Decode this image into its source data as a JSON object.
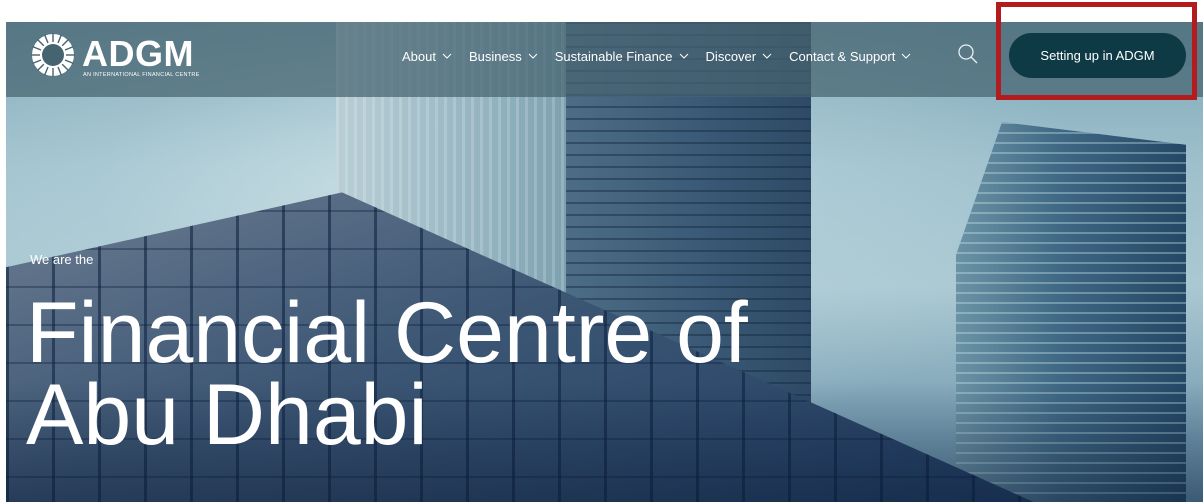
{
  "brand": {
    "name": "ADGM",
    "tagline": "AN INTERNATIONAL FINANCIAL CENTRE",
    "logo_icon": "starburst-ring-icon"
  },
  "nav": {
    "items": [
      {
        "label": "About",
        "has_dropdown": true
      },
      {
        "label": "Business",
        "has_dropdown": true
      },
      {
        "label": "Sustainable Finance",
        "has_dropdown": true
      },
      {
        "label": "Discover",
        "has_dropdown": true
      },
      {
        "label": "Contact & Support",
        "has_dropdown": true
      }
    ],
    "search_icon": "search-icon",
    "cta_label": "Setting up in ADGM"
  },
  "hero": {
    "eyebrow": "We are the",
    "headline_line1": "Financial Centre of",
    "headline_line2": "Abu Dhabi"
  },
  "colors": {
    "cta_background": "#0e3a45",
    "highlight_frame": "#b21c1f",
    "text": "#ffffff"
  }
}
